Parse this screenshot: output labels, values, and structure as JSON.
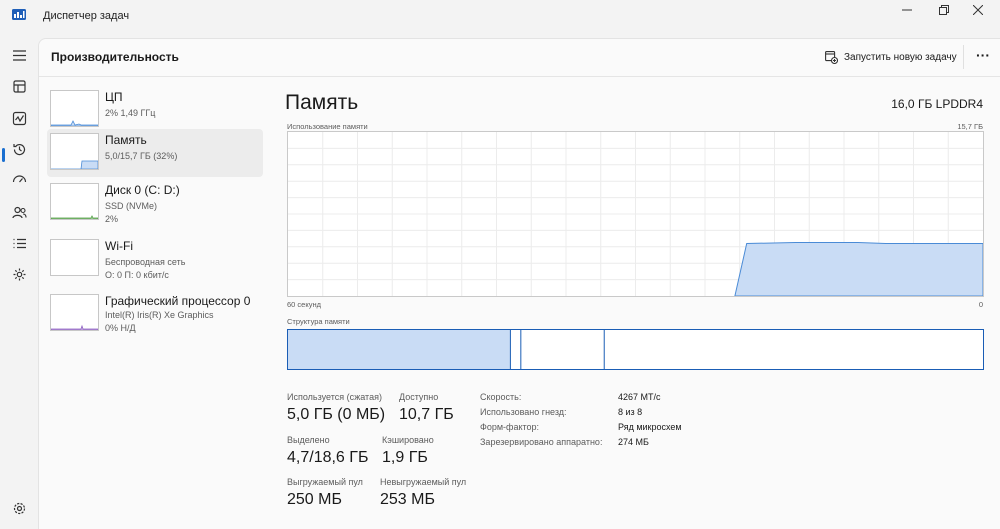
{
  "window": {
    "title": "Диспетчер задач",
    "controls": [
      "minimize",
      "maximize",
      "close"
    ]
  },
  "rail": {
    "icons": [
      "hamburger-icon",
      "processes-icon",
      "performance-icon",
      "history-icon",
      "startup-icon",
      "users-icon",
      "details-icon",
      "services-icon",
      "settings-icon"
    ],
    "selected": "performance-icon"
  },
  "header": {
    "title": "Производительность",
    "run_task_label": "Запустить новую задачу",
    "more_label": "···"
  },
  "devices": [
    {
      "name": "ЦП",
      "line1": "2%  1,49 ГГц",
      "line2": ""
    },
    {
      "name": "Память",
      "line1": "5,0/15,7 ГБ (32%)",
      "line2": ""
    },
    {
      "name": "Диск 0 (C: D:)",
      "line1": "SSD (NVMe)",
      "line2": "2%"
    },
    {
      "name": "Wi-Fi",
      "line1": "Беспроводная сеть",
      "line2": "О: 0  П: 0 кбит/с"
    },
    {
      "name": "Графический процессор 0",
      "line1": "Intel(R) Iris(R) Xe Graphics",
      "line2": "0% Н/Д"
    }
  ],
  "detail": {
    "title": "Память",
    "spec": "16,0 ГБ LPDDR4",
    "usage_label": "Использование памяти",
    "usage_max": "15,7 ГБ",
    "time_left": "60 секунд",
    "time_right": "0",
    "structure_label": "Структура памяти",
    "usage_level": 0.32,
    "structure": {
      "in_use_fraction": 0.32,
      "modified_fraction": 0.015,
      "standby_fraction": 0.12
    }
  },
  "stats": {
    "in_use": {
      "label": "Используется (сжатая)",
      "value": "5,0 ГБ (0 МБ)"
    },
    "available": {
      "label": "Доступно",
      "value": "10,7 ГБ"
    },
    "committed": {
      "label": "Выделено",
      "value": "4,7/18,6 ГБ"
    },
    "cached": {
      "label": "Кэшировано",
      "value": "1,9 ГБ"
    },
    "paged_pool": {
      "label": "Выгружаемый пул",
      "value": "250 МБ"
    },
    "nonpaged_pool": {
      "label": "Невыгружаемый пул",
      "value": "253 МБ"
    }
  },
  "props": [
    {
      "key": "Скорость:",
      "value": "4267 МТ/с"
    },
    {
      "key": "Использовано гнезд:",
      "value": "8 из 8"
    },
    {
      "key": "Форм-фактор:",
      "value": "Ряд микросхем"
    },
    {
      "key": "Зарезервировано аппаратно:",
      "value": "274 МБ"
    }
  ],
  "colors": {
    "memory_fill": "#c9dcf5",
    "memory_line": "#4a8bd6",
    "accent": "#1a6fd0"
  }
}
